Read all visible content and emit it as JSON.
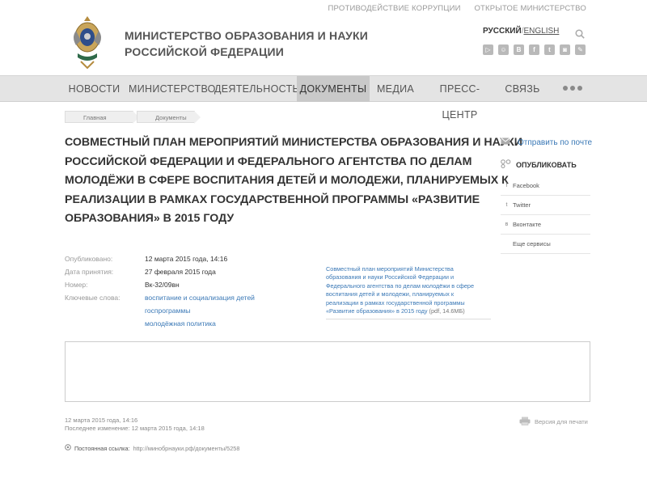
{
  "top_links": [
    "ПРОТИВОДЕЙСТВИЕ КОРРУПЦИИ",
    "ОТКРЫТОЕ МИНИСТЕРСТВО"
  ],
  "site": {
    "ministry_line1": "МИНИСТЕРСТВО ОБРАЗОВАНИЯ И НАУКИ",
    "ministry_line2": "РОССИЙСКОЙ ФЕДЕРАЦИИ"
  },
  "lang": {
    "ru": "РУССКИЙ",
    "sep": "/",
    "en": "ENGLISH"
  },
  "socials": [
    {
      "icon": "youtube-icon",
      "glyph": "▷"
    },
    {
      "icon": "livejournal-icon",
      "glyph": "☺"
    },
    {
      "icon": "vkontakte-icon",
      "glyph": "B"
    },
    {
      "icon": "facebook-icon",
      "glyph": "f"
    },
    {
      "icon": "twitter-icon",
      "glyph": "t"
    },
    {
      "icon": "instagram-icon",
      "glyph": "◙"
    },
    {
      "icon": "rss-icon",
      "glyph": "✎"
    }
  ],
  "nav": [
    "НОВОСТИ",
    "МИНИСТЕРСТВО",
    "ДЕЯТЕЛЬНОСТЬ",
    "ДОКУМЕНТЫ",
    "МЕДИА",
    "ПРЕСС-ЦЕНТР",
    "СВЯЗЬ"
  ],
  "nav_active": "ДОКУМЕНТЫ",
  "breadcrumb": [
    "Главная",
    "Документы"
  ],
  "headline_lines": [
    "СОВМЕСТНЫЙ ПЛАН МЕРОПРИЯТИЙ МИНИСТЕРСТВА ОБРАЗОВАНИЯ И НАУКИ",
    "РОССИЙСКОЙ ФЕДЕРАЦИИ И ФЕДЕРАЛЬНОГО АГЕНТСТВА ПО ДЕЛАМ",
    "МОЛОДЁЖИ В СФЕРЕ ВОСПИТАНИЯ ДЕТЕЙ И МОЛОДЕЖИ, ПЛАНИРУЕМЫХ К",
    "РЕАЛИЗАЦИИ В РАМКАХ ГОСУДАРСТВЕННОЙ ПРОГРАММЫ «РАЗВИТИЕ",
    "ОБРАЗОВАНИЯ» В 2015 ГОДУ"
  ],
  "meta": {
    "published_label": "Опубликовано:",
    "published_value": "12 марта 2015 года, 14:16",
    "adopted_label": "Дата принятия:",
    "adopted_value": "27 февраля 2015 года",
    "number_label": "Номер:",
    "number_value": "Вк-32/09вн",
    "keywords_label": "Ключевые слова:",
    "keywords": [
      "воспитание и социализация детей",
      "госпрограммы",
      "молодёжная политика"
    ]
  },
  "doc_file": {
    "lines": [
      "Совместный план мероприятий Министерства",
      "образования и науки Российской Федерации и",
      "Федерального агентства по делам молодёжи в сфере",
      "воспитания детей и молодежи, планируемых к",
      "реализации в рамках государственной программы",
      "«Развитие образования» в 2015 году"
    ],
    "size": " (pdf, 14.6МБ)"
  },
  "sidebar": {
    "mail_label": "Отправить по почте",
    "publish_label": "ОПУБЛИКОВАТЬ",
    "items": [
      {
        "label": "Facebook",
        "glyph": "f"
      },
      {
        "label": "Twitter",
        "glyph": "t"
      },
      {
        "label": "Вконтакте",
        "glyph": "в"
      },
      {
        "label": "Еще сервисы",
        "glyph": ""
      }
    ]
  },
  "footer": {
    "date_line1": "12 марта 2015 года, 14:16",
    "date_line2": "Последнее изменение: 12 марта 2015 года, 14:18",
    "print_label": "Версия для печати",
    "permalink_label": "Постоянная ссылка:",
    "permalink_url": "http://минобрнауки.рф/документы/5258"
  },
  "colors": {
    "link": "#3a78b6",
    "nav_bg": "#e4e4e4",
    "nav_active": "#c9c9c9"
  }
}
